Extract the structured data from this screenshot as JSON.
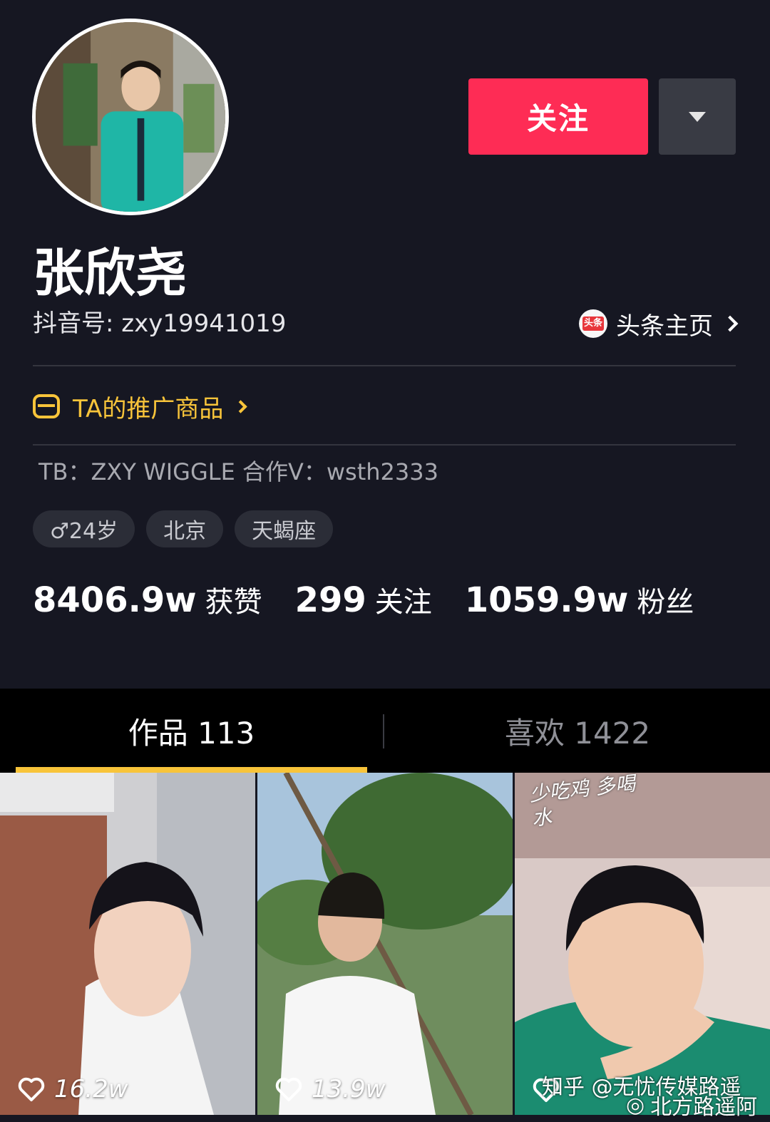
{
  "profile": {
    "nickname": "张欣尧",
    "douyin_id": "抖音号: zxy19941019",
    "toutiao_label": "头条主页",
    "toutiao_badge": "头条",
    "follow_label": "关注",
    "promo_label": "TA的推广商品",
    "bio": "TB：ZXY WIGGLE 合作V：wsth2333",
    "tags": [
      "♂24岁",
      "北京",
      "天蝎座"
    ]
  },
  "stats": [
    {
      "value": "8406.9w",
      "label": "获赞"
    },
    {
      "value": "299",
      "label": "关注"
    },
    {
      "value": "1059.9w",
      "label": "粉丝"
    }
  ],
  "tabs": {
    "works": "作品 113",
    "likes": "喜欢 1422"
  },
  "videos": [
    {
      "likes": "16.2w"
    },
    {
      "likes": "13.9w"
    },
    {
      "likes": "",
      "sticker": "少吃鸡 多喝水"
    }
  ],
  "watermark": {
    "line1": "知乎 @无忧传媒路遥",
    "line2": "北方路遥阿"
  },
  "colors": {
    "background": "#161722",
    "follow_button": "#fe2c55",
    "accent_yellow": "#f8c43a"
  }
}
